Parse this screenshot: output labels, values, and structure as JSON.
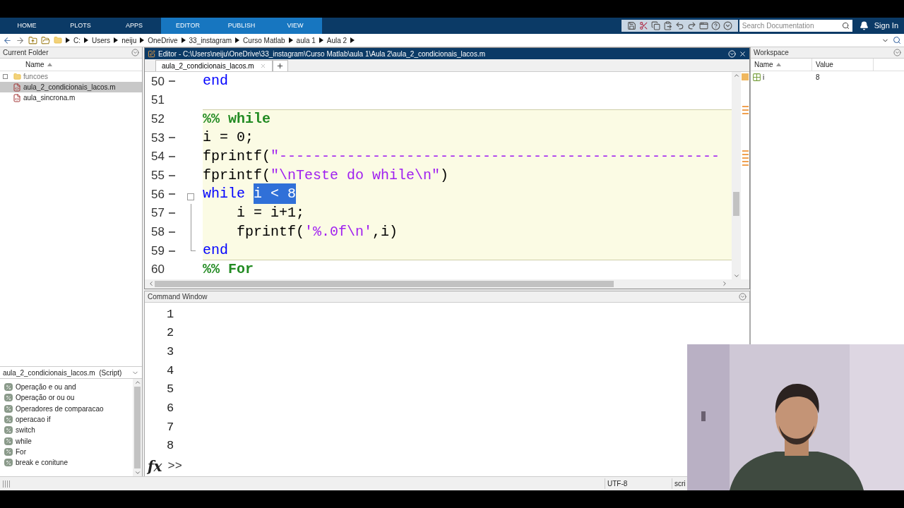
{
  "toolstrip": {
    "tabs": [
      {
        "label": "HOME",
        "contextual": false
      },
      {
        "label": "PLOTS",
        "contextual": false
      },
      {
        "label": "APPS",
        "contextual": false
      },
      {
        "label": "EDITOR",
        "contextual": true
      },
      {
        "label": "PUBLISH",
        "contextual": true
      },
      {
        "label": "VIEW",
        "contextual": true
      }
    ],
    "search": {
      "placeholder": "Search Documentation"
    },
    "sign_in": "Sign In"
  },
  "address_bar": {
    "path": [
      "C:",
      "Users",
      "neiju",
      "OneDrive",
      "33_instagram",
      "Curso Matlab",
      "aula 1",
      "Aula 2"
    ]
  },
  "current_folder": {
    "title": "Current Folder",
    "column": "Name",
    "items": [
      {
        "name": "funcoes",
        "kind": "folder",
        "selected": false
      },
      {
        "name": "aula_2_condicionais_lacos.m",
        "kind": "file",
        "selected": true
      },
      {
        "name": "aula_sincrona.m",
        "kind": "file",
        "selected": false
      }
    ]
  },
  "details": {
    "title": "aula_2_condicionais_lacos.m  (Script)",
    "sections": [
      "Operação e ou and",
      "Operação or ou ou",
      "Operadores de comparacao",
      "operacao if",
      "switch",
      "while",
      "For",
      "break e conitune"
    ]
  },
  "editor": {
    "title": "Editor - C:\\Users\\neiju\\OneDrive\\33_instagram\\Curso Matlab\\aula 1\\Aula 2\\aula_2_condicionais_lacos.m",
    "tabs": [
      {
        "label": "aula_2_condicionais_lacos.m",
        "selected": true
      }
    ],
    "lines": [
      {
        "number": "50",
        "cell": false,
        "executable": true,
        "fold_start": false,
        "in_fold": false,
        "tokens": [
          {
            "kind": "keyword",
            "text": "end"
          }
        ]
      },
      {
        "number": "51",
        "cell": false,
        "executable": false,
        "fold_start": false,
        "in_fold": false
      },
      {
        "number": "52",
        "cell": true,
        "executable": false,
        "fold_start": false,
        "in_fold": false,
        "tokens": [
          {
            "kind": "comment",
            "text": "%% while"
          }
        ]
      },
      {
        "number": "53",
        "cell": true,
        "executable": true,
        "fold_start": false,
        "in_fold": false,
        "tokens": [
          {
            "kind": "plain",
            "text": "i = 0;"
          }
        ]
      },
      {
        "number": "54",
        "cell": true,
        "executable": true,
        "fold_start": false,
        "in_fold": false,
        "tokens": [
          {
            "kind": "plain",
            "text": "fprintf("
          },
          {
            "kind": "string",
            "text": "\"----------------------------------------------------"
          }
        ]
      },
      {
        "number": "55",
        "cell": true,
        "executable": true,
        "fold_start": false,
        "in_fold": false,
        "tokens": [
          {
            "kind": "plain",
            "text": "fprintf("
          },
          {
            "kind": "string",
            "text": "\"\\nTeste do while\\n\""
          },
          {
            "kind": "plain",
            "text": ")"
          }
        ]
      },
      {
        "number": "56",
        "cell": true,
        "executable": true,
        "fold_start": true,
        "in_fold": false,
        "tokens": [
          {
            "kind": "keyword",
            "text": "while"
          },
          {
            "kind": "selection",
            "text": "i < 8"
          }
        ]
      },
      {
        "number": "57",
        "cell": true,
        "executable": true,
        "fold_start": false,
        "in_fold": true,
        "tokens": [
          {
            "kind": "plain",
            "text": "    i = i+1;"
          }
        ]
      },
      {
        "number": "58",
        "cell": true,
        "executable": true,
        "fold_start": false,
        "in_fold": true,
        "tokens": [
          {
            "kind": "plain",
            "text": "    fprintf("
          },
          {
            "kind": "string",
            "text": "'%.0f\\n'"
          },
          {
            "kind": "plain",
            "text": ",i)"
          }
        ]
      },
      {
        "number": "59",
        "cell": true,
        "executable": true,
        "fold_start": false,
        "in_fold": true,
        "tokens": [
          {
            "kind": "keyword",
            "text": "end"
          }
        ]
      },
      {
        "number": "60",
        "cell": false,
        "executable": false,
        "fold_start": false,
        "in_fold": false,
        "tokens": [
          {
            "kind": "comment",
            "text": "%% For"
          }
        ]
      }
    ]
  },
  "command_window": {
    "title": "Command Window",
    "output": [
      "1",
      "2",
      "3",
      "4",
      "5",
      "6",
      "7",
      "8"
    ],
    "prompt_icon": "fx",
    "prompt": ">>"
  },
  "workspace": {
    "title": "Workspace",
    "columns": [
      "Name",
      "Value"
    ],
    "rows": [
      {
        "name": "i",
        "value": "8"
      }
    ]
  },
  "status_bar": {
    "encoding": "UTF-8",
    "mode": "scri"
  }
}
